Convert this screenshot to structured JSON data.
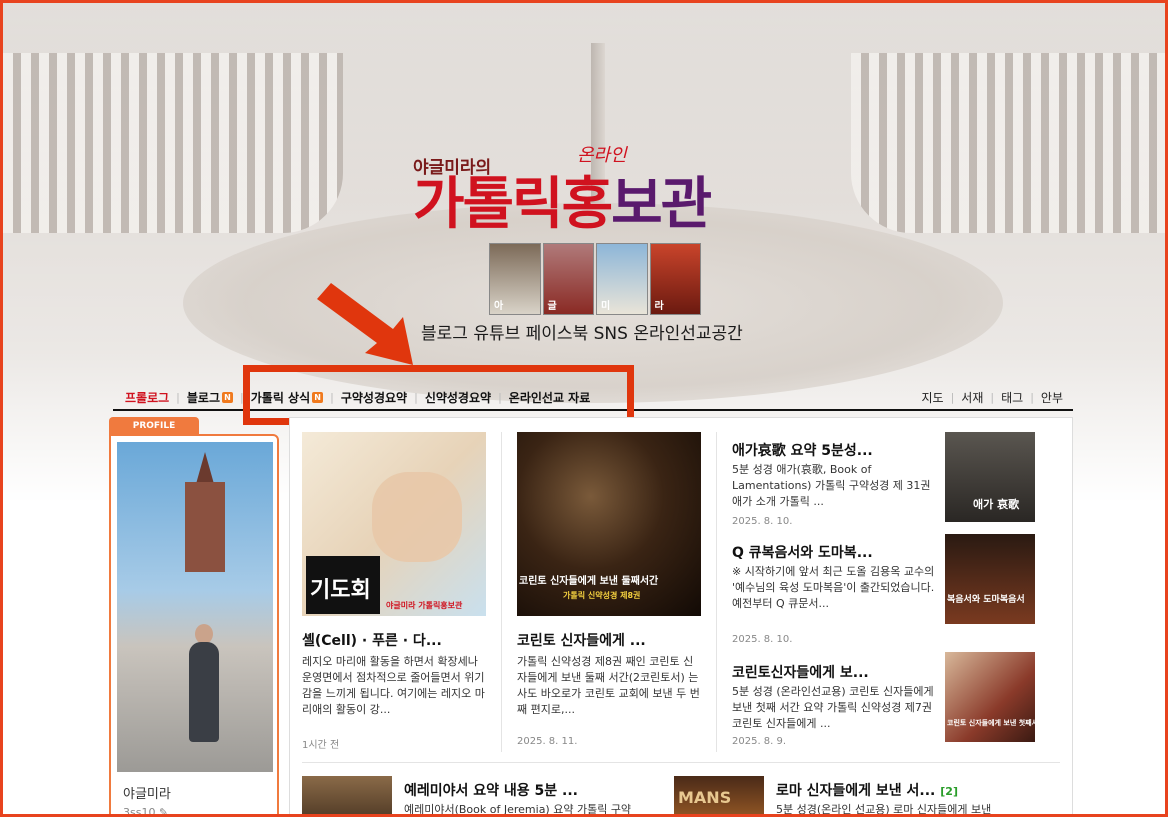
{
  "header": {
    "logo_sub": "야글미라의",
    "logo_online": "온라인",
    "logo_main_a": "가톨릭",
    "logo_main_b": "홍",
    "logo_main_c": "보관",
    "saints": [
      "아",
      "글",
      "미",
      "라"
    ],
    "slogan": "블로그 유튜브 페이스북 SNS 온라인선교공간"
  },
  "nav": {
    "left": [
      {
        "label": "프롤로그",
        "active": true,
        "new": false
      },
      {
        "label": "블로그",
        "active": false,
        "new": true
      },
      {
        "label": "가톨릭 상식",
        "active": false,
        "new": true
      },
      {
        "label": "구약성경요약",
        "active": false,
        "new": false
      },
      {
        "label": "신약성경요약",
        "active": false,
        "new": false
      },
      {
        "label": "온라인선교 자료",
        "active": false,
        "new": false
      }
    ],
    "right": [
      "지도",
      "서재",
      "태그",
      "안부"
    ],
    "new_badge": "N"
  },
  "profile": {
    "tab_label": "PROFILE",
    "name": "야글미라",
    "id": "3ss10"
  },
  "cards": [
    {
      "thumb_label": "기도회",
      "thumb_small": "야글미라 가톨릭홍보관",
      "title": "셸(Cell) · 푸른 · 다...",
      "desc": "레지오 마리애 활동을 하면서 확장세나 운영면에서 점차적으로 줄어들면서 위기감을 느끼게 됩니다. 여기에는 레지오 마리애의 활동이 강...",
      "date": "1시간 전"
    },
    {
      "thumb_label": "코린토 신자들에게 보낸 둘째서간",
      "thumb_small": "가톨릭 신약성경 제8권",
      "title": "코린토 신자들에게 ...",
      "desc": "가톨릭 신약성경 제8권 째인 코린토 신자들에게 보낸 둘째 서간(2코린토서) 는 사도 바오로가 코린토 교회에 보낸 두 번째 편지로,...",
      "date": "2025. 8. 11."
    }
  ],
  "side_posts": [
    {
      "title": "애가哀歌 요약 5분성...",
      "desc": "5분 성경 애가(哀歌, Book of Lamentations) 가톨릭 구약성경 제 31권 애가 소개 가톨릭 ...",
      "date": "2025. 8. 10.",
      "thumb_label": "애가 哀歌"
    },
    {
      "title": "Q 큐복음서와 도마복...",
      "desc": "※ 시작하기에 앞서 최근 도올 김용옥 교수의 '예수님의 육성 도마복음'이 출간되었습니다. 예전부터 Q 큐문서...",
      "date": "2025. 8. 10.",
      "thumb_label": "복음서와 도마복음서"
    },
    {
      "title": "코린토신자들에게 보...",
      "desc": "5분 성경 (온라인선교용) 코린토 신자들에게 보낸 첫째 서간 요약 가톨릭 신약성경 제7권 코린토 신자들에게 ...",
      "date": "2025. 8. 9.",
      "thumb_label": "코린토 신자들에게 보낸 첫째서간"
    }
  ],
  "bottom_posts": [
    {
      "title": "예레미야서 요약 내용 5분 ...",
      "desc": "예레미야서(Book of Jeremia) 요약 가톨릭 구약"
    },
    {
      "title": "로마 신자들에게 보낸 서...",
      "count": "[2]",
      "desc": "5분 성경(온라인 선교용) 로마 신자들에게 보낸",
      "thumb_label": "MANS"
    }
  ]
}
